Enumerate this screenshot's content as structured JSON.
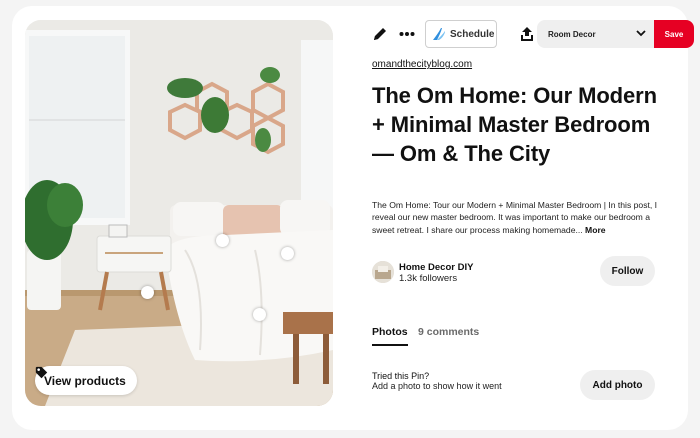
{
  "toolbar": {
    "edit_icon": "pencil-icon",
    "more_icon": "ellipsis-icon",
    "schedule_label": "Schedule",
    "share_icon": "upload-icon",
    "board_name": "Room Decor",
    "save_label": "Save",
    "accent_color": "#e60023"
  },
  "image": {
    "view_products_label": "View products",
    "hotspot_count": 5
  },
  "pin": {
    "source": "omandthecityblog.com",
    "title": "The Om Home: Our Modern + Minimal Master Bedroom — Om & The City",
    "description": "The Om Home: Tour our Modern + Minimal Master Bedroom | In this post, I reveal our new master bedroom. It was important to make our bedroom a sweet retreat. I share our process making homemade...",
    "more_label": "More"
  },
  "creator": {
    "name": "Home Decor DIY",
    "followers": "1.3k followers",
    "follow_label": "Follow"
  },
  "tabs": {
    "photos_label": "Photos",
    "comments_label": "9 comments"
  },
  "tried": {
    "title": "Tried this Pin?",
    "subtitle": "Add a photo to show how it went",
    "add_photo_label": "Add photo"
  }
}
